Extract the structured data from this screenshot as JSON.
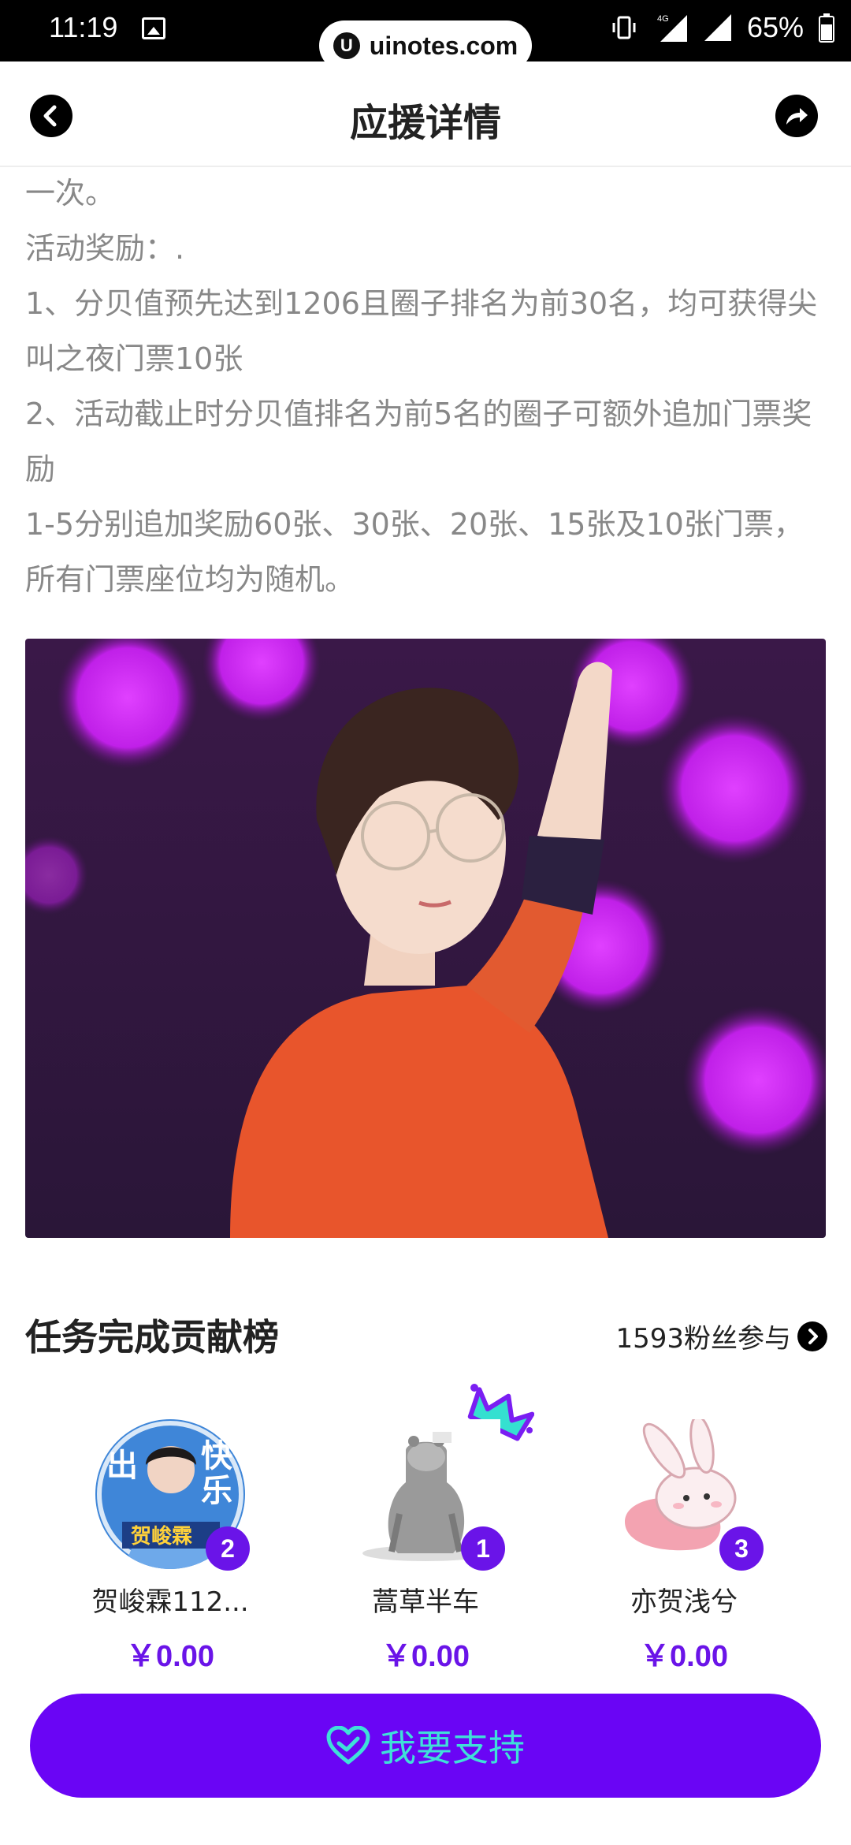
{
  "status_bar": {
    "time": "11:19",
    "battery": "65%",
    "network": "4G"
  },
  "watermark": {
    "logo": "U",
    "text": "uinotes.com"
  },
  "header": {
    "title": "应援详情"
  },
  "content": {
    "paragraphs": [
      "一次。",
      "活动奖励：.",
      "1、分贝值预先达到1206且圈子排名为前30名，均可获得尖叫之夜门票10张",
      "2、活动截止时分贝值排名为前5名的圈子可额外追加门票奖励",
      "1-5分别追加奖励60张、30张、20张、15张及10张门票，所有门票座位均为随机。"
    ]
  },
  "ranking": {
    "title": "任务完成贡献榜",
    "participants": "1593粉丝参与",
    "entries": [
      {
        "rank": "2",
        "name": "贺峻霖112...",
        "amount": "￥0.00"
      },
      {
        "rank": "1",
        "name": "蒿草半车",
        "amount": "￥0.00"
      },
      {
        "rank": "3",
        "name": "亦贺浅兮",
        "amount": "￥0.00"
      }
    ],
    "avatar1_text": {
      "line1": "出",
      "line2": "快",
      "line3": "乐",
      "name": "贺峻霖"
    }
  },
  "support_button": {
    "label": "我要支持"
  },
  "colors": {
    "accent": "#6a05f5",
    "button_text": "#3fe0d8",
    "badge": "#6a14e8"
  }
}
